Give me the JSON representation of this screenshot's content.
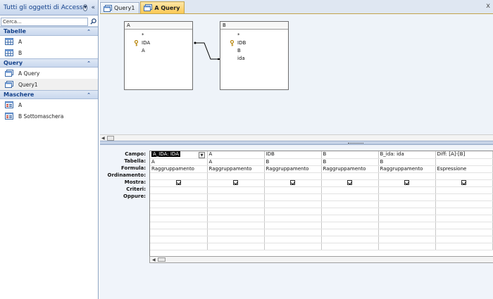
{
  "nav": {
    "title": "Tutti gli oggetti di Access",
    "search_placeholder": "Cerca...",
    "groups": [
      {
        "label": "Tabelle",
        "items": [
          {
            "label": "A"
          },
          {
            "label": "B"
          }
        ]
      },
      {
        "label": "Query",
        "items": [
          {
            "label": "A Query"
          },
          {
            "label": "Query1"
          }
        ]
      },
      {
        "label": "Maschere",
        "items": [
          {
            "label": "A"
          },
          {
            "label": "B Sottomaschera"
          }
        ]
      }
    ]
  },
  "tabs": [
    {
      "label": "Query1",
      "active": false
    },
    {
      "label": "A Query",
      "active": true
    }
  ],
  "tab_close": "x",
  "tables": [
    {
      "name": "A",
      "fields": [
        {
          "label": "*",
          "key": false
        },
        {
          "label": "IDA",
          "key": true
        },
        {
          "label": "A",
          "key": false
        }
      ]
    },
    {
      "name": "B",
      "fields": [
        {
          "label": "*",
          "key": false
        },
        {
          "label": "IDB",
          "key": true
        },
        {
          "label": "B",
          "key": false
        },
        {
          "label": "ida",
          "key": false
        }
      ]
    }
  ],
  "grid": {
    "row_labels": [
      "Campo:",
      "Tabella:",
      "Formula:",
      "Ordinamento:",
      "Mostra:",
      "Criteri:",
      "Oppure:"
    ],
    "columns": [
      {
        "campo": "A_IDA: IDA",
        "tabella": "A",
        "formula": "Raggruppamento",
        "ordinamento": "",
        "mostra": true
      },
      {
        "campo": "A",
        "tabella": "A",
        "formula": "Raggruppamento",
        "ordinamento": "",
        "mostra": true
      },
      {
        "campo": "IDB",
        "tabella": "B",
        "formula": "Raggruppamento",
        "ordinamento": "",
        "mostra": true
      },
      {
        "campo": "B",
        "tabella": "B",
        "formula": "Raggruppamento",
        "ordinamento": "",
        "mostra": true
      },
      {
        "campo": "B_ida: ida",
        "tabella": "B",
        "formula": "Raggruppamento",
        "ordinamento": "",
        "mostra": true
      },
      {
        "campo": "Diff: [A]-[B]",
        "tabella": "",
        "formula": "Espressione",
        "ordinamento": "",
        "mostra": true
      }
    ]
  },
  "colors": {
    "active_tab": "#fbc955",
    "nav_header_text": "#15428b",
    "design_bg": "#eef3f9"
  }
}
